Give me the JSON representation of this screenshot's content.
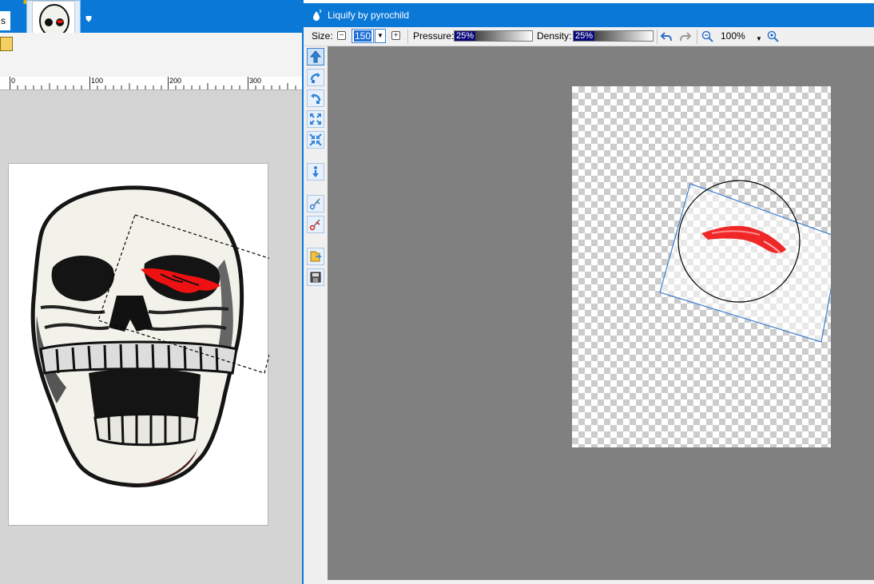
{
  "background_app": {
    "tab_fragment": "s",
    "ruler": {
      "labels": [
        "0",
        "100",
        "200",
        "300"
      ]
    }
  },
  "liquify": {
    "title": "Liquify by pyrochild",
    "toolbar": {
      "size_label": "Size:",
      "size_value": "150",
      "pressure_label": "Pressure:",
      "pressure_value": "25%",
      "density_label": "Density:",
      "density_value": "25%",
      "zoom_value": "100%"
    },
    "sidebar_tools": [
      "push-tool-icon",
      "twirl-cw-tool-icon",
      "twirl-ccw-tool-icon",
      "expand-tool-icon",
      "shrink-tool-icon",
      "move-down-tool-icon",
      "reconstruct-tool-icon",
      "reconstruct-red-tool-icon",
      "open-file-icon",
      "save-icon"
    ],
    "colors": {
      "titlebar": "#0a78d7",
      "selection_box": "#3c7fd1",
      "canvas_bg": "#808080",
      "flame": "#ee1111"
    }
  }
}
